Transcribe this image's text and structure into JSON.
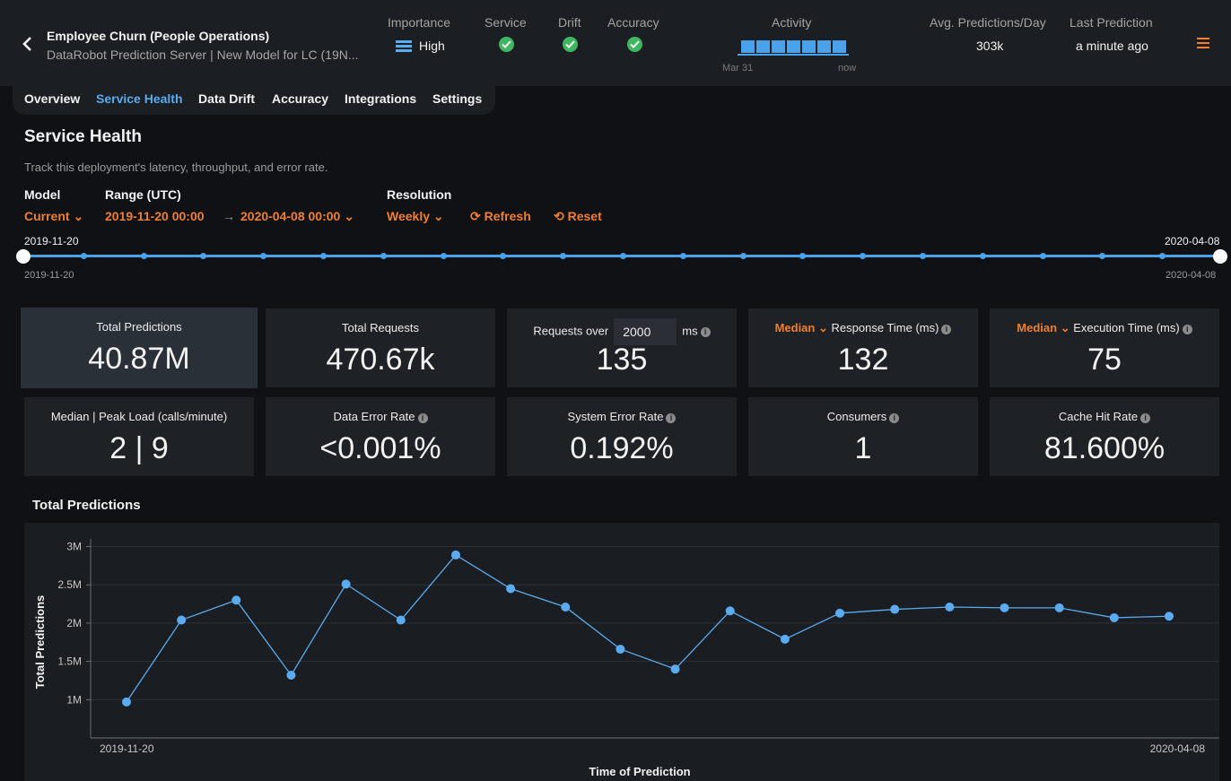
{
  "header": {
    "title": "Employee Churn (People Operations)",
    "subtitle": "DataRobot Prediction Server | New Model for LC (19N...",
    "importance_label": "Importance",
    "importance_value": "High",
    "service_label": "Service",
    "drift_label": "Drift",
    "accuracy_label": "Accuracy",
    "activity_label": "Activity",
    "activity_start": "Mar 31",
    "activity_end": "now",
    "avg_pred_label": "Avg. Predictions/Day",
    "avg_pred_value": "303k",
    "last_pred_label": "Last Prediction",
    "last_pred_value": "a minute ago",
    "accent": "#f07f2f",
    "ok_color": "#3fb761"
  },
  "tabs": [
    "Overview",
    "Service Health",
    "Data Drift",
    "Accuracy",
    "Integrations",
    "Settings"
  ],
  "page": {
    "title": "Service Health",
    "description": "Track this deployment's latency, throughput, and error rate."
  },
  "filters": {
    "model_label": "Model",
    "model_value": "Current",
    "range_label": "Range (UTC)",
    "range_start": "2019-11-20  00:00",
    "range_end": "2020-04-08  00:00",
    "resolution_label": "Resolution",
    "resolution_value": "Weekly",
    "refresh_label": "Refresh",
    "reset_label": "Reset"
  },
  "slider": {
    "start_top": "2019-11-20",
    "end_top": "2020-04-08",
    "start_bottom": "2019-11-20",
    "end_bottom": "2020-04-08"
  },
  "tiles": {
    "total_predictions": {
      "label": "Total Predictions",
      "value": "40.87M"
    },
    "total_requests": {
      "label": "Total Requests",
      "value": "470.67k"
    },
    "requests_over": {
      "prefix": "Requests over",
      "threshold": "2000",
      "suffix": "ms",
      "value": "135"
    },
    "response_time": {
      "stat": "Median",
      "label": "Response Time (ms)",
      "value": "132"
    },
    "execution_time": {
      "stat": "Median",
      "label": "Execution Time (ms)",
      "value": "75"
    },
    "load": {
      "label": "Median | Peak Load (calls/minute)",
      "value": "2 | 9"
    },
    "data_error": {
      "label": "Data Error Rate",
      "value": "<0.001%"
    },
    "system_error": {
      "label": "System Error Rate",
      "value": "0.192%"
    },
    "consumers": {
      "label": "Consumers",
      "value": "1"
    },
    "cache_hit": {
      "label": "Cache Hit Rate",
      "value": "81.600%"
    }
  },
  "chart_data": {
    "type": "line",
    "title": "Total Predictions",
    "xlabel": "Time of Prediction",
    "ylabel": "Total Predictions",
    "x_tick_labels": [
      "2019-11-20",
      "2020-04-08"
    ],
    "y_ticks": [
      1000000,
      1500000,
      2000000,
      2500000,
      3000000
    ],
    "y_tick_labels": [
      "1M",
      "1.5M",
      "2M",
      "2.5M",
      "3M"
    ],
    "ylim": [
      500000,
      3100000
    ],
    "grid": true,
    "color": "#5aabef",
    "series": [
      {
        "values": [
          970000,
          2040000,
          2300000,
          1320000,
          2510000,
          2040000,
          2890000,
          2450000,
          2210000,
          1660000,
          1400000,
          2160000,
          1790000,
          2130000,
          2180000,
          2210000,
          2200000,
          2200000,
          2070000,
          2090000
        ]
      }
    ]
  }
}
